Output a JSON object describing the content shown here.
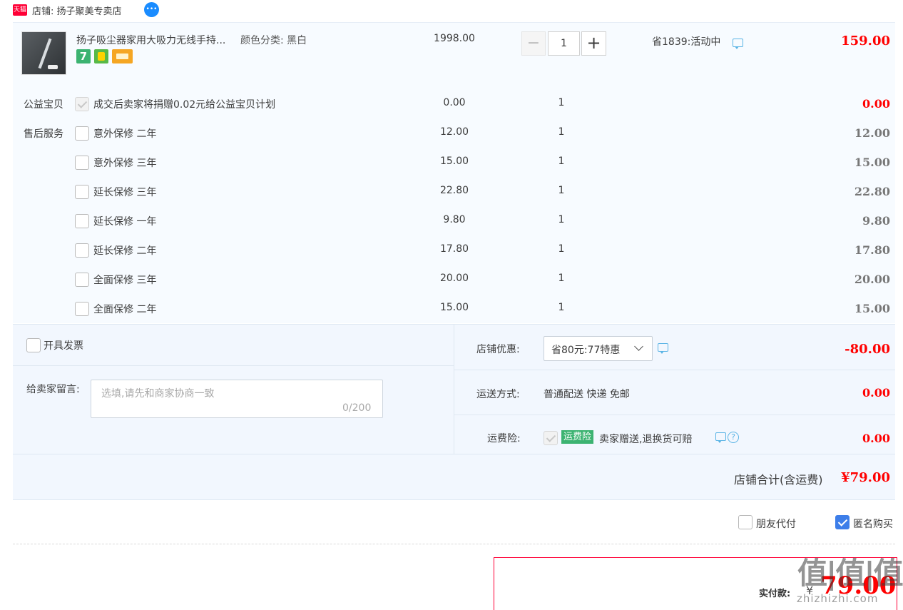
{
  "shop": {
    "tmall_logo_text": "天猫",
    "name_label": "店铺: 扬子聚美专卖店",
    "wangwang_icon": "chat-bubble-icon"
  },
  "product": {
    "title": "扬子吸尘器家用大吸力无线手持...",
    "sku": "颜色分类: 黑白",
    "badge_7": "7",
    "unit_price": "1998.00",
    "quantity": "1",
    "minus": "−",
    "plus": "+",
    "saving": "省1839:活动中",
    "total": "159.00"
  },
  "charity": {
    "label": "公益宝贝",
    "text": "成交后卖家将捐赠0.02元给公益宝贝计划",
    "price": "0.00",
    "qty": "1",
    "total": "0.00"
  },
  "services": {
    "label": "售后服务",
    "items": [
      {
        "name": "意外保修 二年",
        "price": "12.00",
        "qty": "1",
        "total": "12.00"
      },
      {
        "name": "意外保修 三年",
        "price": "15.00",
        "qty": "1",
        "total": "15.00"
      },
      {
        "name": "延长保修 三年",
        "price": "22.80",
        "qty": "1",
        "total": "22.80"
      },
      {
        "name": "延长保修 一年",
        "price": "9.80",
        "qty": "1",
        "total": "9.80"
      },
      {
        "name": "延长保修 二年",
        "price": "17.80",
        "qty": "1",
        "total": "17.80"
      },
      {
        "name": "全面保修 三年",
        "price": "20.00",
        "qty": "1",
        "total": "20.00"
      },
      {
        "name": "全面保修 二年",
        "price": "15.00",
        "qty": "1",
        "total": "15.00"
      }
    ]
  },
  "invoice": {
    "label": "开具发票"
  },
  "message": {
    "label": "给卖家留言:",
    "placeholder": "选填,请先和商家协商一致",
    "counter": "0/200"
  },
  "discount": {
    "label": "店铺优惠:",
    "selected": "省80元:77特惠",
    "amount": "-80.00"
  },
  "shipping": {
    "label": "运送方式:",
    "value": "普通配送 快递 免邮",
    "amount": "0.00"
  },
  "insurance": {
    "label": "运费险:",
    "tag": "运费险",
    "text": "卖家赠送,退换货可赔",
    "help": "?",
    "amount": "0.00"
  },
  "shop_total": {
    "label": "店铺合计(含运费)",
    "amount": "¥79.00"
  },
  "options": {
    "friend_pay": "朋友代付",
    "anonymous": "匿名购买"
  },
  "payment": {
    "label": "实付款:",
    "yen": "¥",
    "amount": "79.00"
  },
  "watermark": {
    "text": "值|值|值",
    "url": "zhizhizhi.com"
  },
  "colors": {
    "price_red": "#ff0000",
    "panel_bg": "#f2f7fe",
    "checkbox_blue": "#3d7ee9",
    "insurance_green": "#3cb371"
  }
}
